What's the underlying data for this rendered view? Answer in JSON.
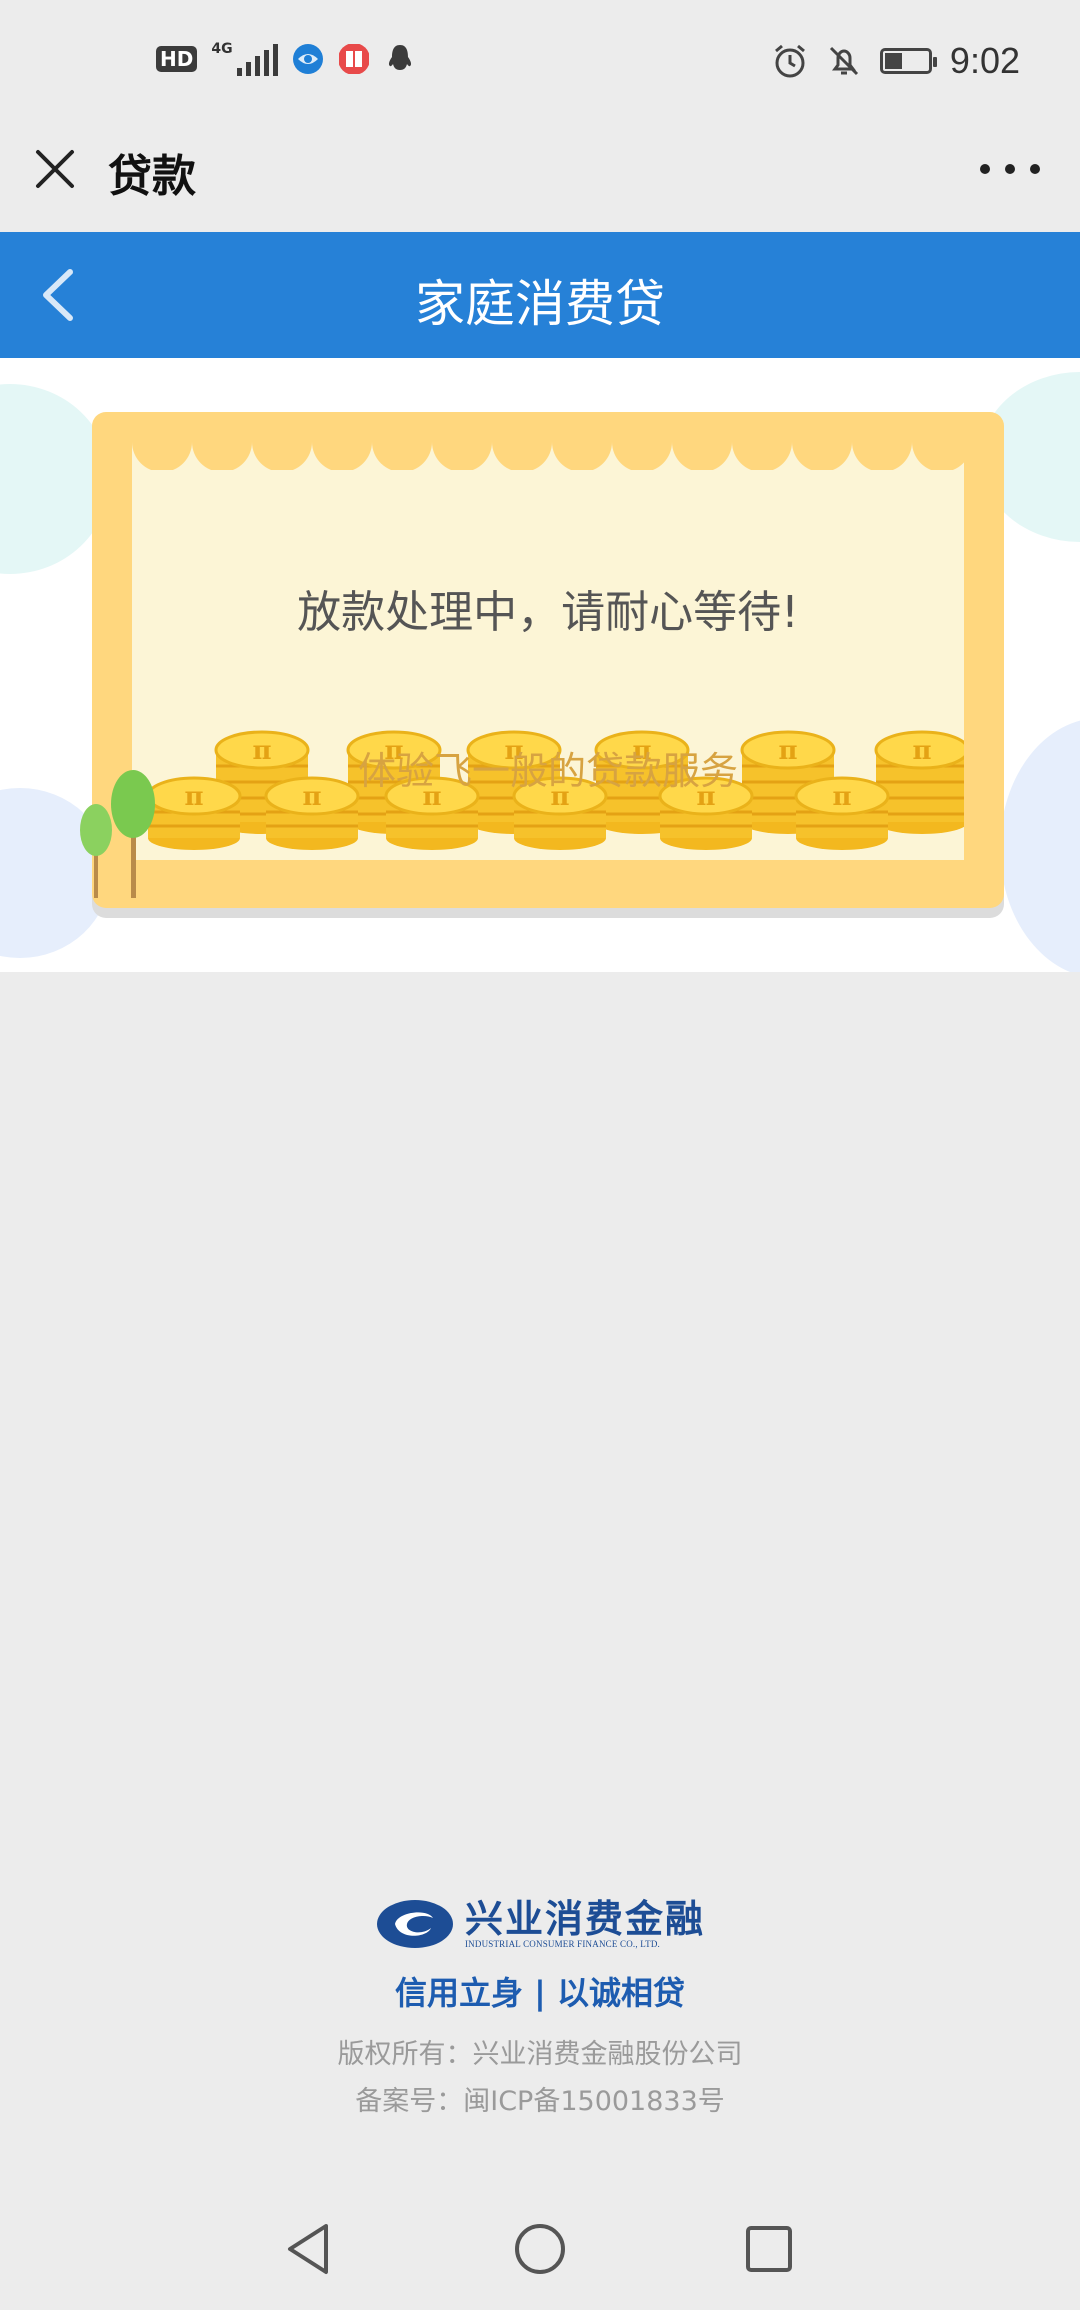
{
  "status_bar": {
    "hd_badge": "HD",
    "network": "4G",
    "time": "9:02",
    "icons": [
      "hd-icon",
      "signal-icon",
      "browser-app-icon",
      "book-app-icon",
      "qq-icon",
      "alarm-icon",
      "mute-bell-icon",
      "battery-icon"
    ]
  },
  "titlebar": {
    "title": "贷款",
    "close_icon": "close-icon",
    "more_icon": "more-icon"
  },
  "header": {
    "title": "家庭消费贷",
    "back_icon": "back-arrow-icon",
    "color": "#2681d7"
  },
  "banner": {
    "message": "放款处理中，请耐心等待!",
    "subtitle": "体验飞一般的贷款服务",
    "coin_symbol": "π",
    "frame_color": "#ffd77e",
    "inner_color": "#fcf5d6"
  },
  "footer": {
    "logo_cn": "兴业消费金融",
    "logo_en": "INDUSTRIAL CONSUMER FINANCE CO., LTD.",
    "slogan": "信用立身 | 以诚相贷",
    "copyright": "版权所有：兴业消费金融股份公司",
    "icp": "备案号：闽ICP备15001833号",
    "brand_color": "#1d4d95"
  },
  "navbar": {
    "buttons": [
      "back-triangle-icon",
      "home-circle-icon",
      "recents-square-icon"
    ]
  }
}
